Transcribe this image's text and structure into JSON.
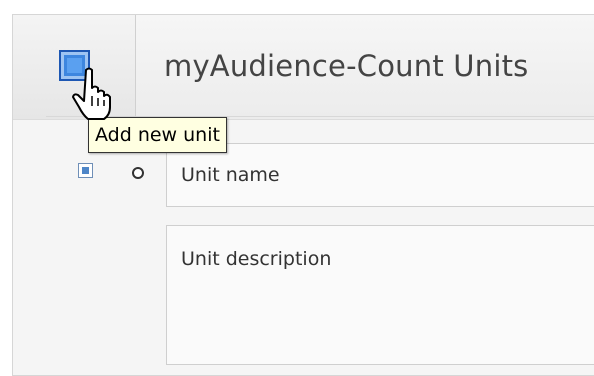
{
  "panel": {
    "title": "myAudience-Count Units",
    "add_button_tooltip": "Add new unit"
  },
  "form": {
    "unit_name_placeholder": "Unit name",
    "unit_description_placeholder": "Unit description"
  },
  "colors": {
    "accent": "#3d86df",
    "tooltip_bg": "#ffffe1"
  },
  "icons": {
    "add": "add-unit-icon",
    "cursor": "hand-pointer-icon",
    "row": "unit-row-icon",
    "radio": "radio-icon"
  }
}
